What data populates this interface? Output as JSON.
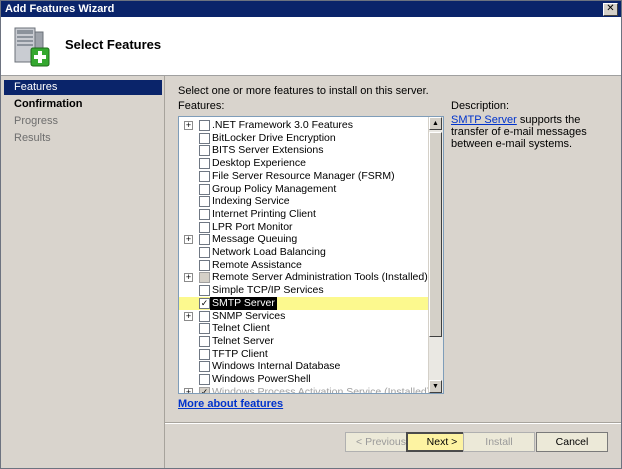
{
  "window": {
    "title": "Add Features Wizard"
  },
  "header": {
    "title": "Select Features"
  },
  "nav": {
    "items": [
      {
        "label": "Features",
        "state": "active"
      },
      {
        "label": "Confirmation",
        "state": "current"
      },
      {
        "label": "Progress",
        "state": "disabled"
      },
      {
        "label": "Results",
        "state": "disabled"
      }
    ]
  },
  "main": {
    "instruction": "Select one or more features to install on this server.",
    "features_label": "Features:",
    "description_label": "Description:",
    "description_link": "SMTP Server",
    "description_text": " supports the transfer of e-mail messages between e-mail systems.",
    "more_link": "More about features",
    "features": [
      {
        "label": ".NET Framework 3.0 Features",
        "expandable": true,
        "checked": false
      },
      {
        "label": "BitLocker Drive Encryption",
        "expandable": false,
        "checked": false
      },
      {
        "label": "BITS Server Extensions",
        "expandable": false,
        "checked": false
      },
      {
        "label": "Desktop Experience",
        "expandable": false,
        "checked": false
      },
      {
        "label": "File Server Resource Manager (FSRM)",
        "expandable": false,
        "checked": false
      },
      {
        "label": "Group Policy Management",
        "expandable": false,
        "checked": false
      },
      {
        "label": "Indexing Service",
        "expandable": false,
        "checked": false
      },
      {
        "label": "Internet Printing Client",
        "expandable": false,
        "checked": false
      },
      {
        "label": "LPR Port Monitor",
        "expandable": false,
        "checked": false
      },
      {
        "label": "Message Queuing",
        "expandable": true,
        "checked": false
      },
      {
        "label": "Network Load Balancing",
        "expandable": false,
        "checked": false
      },
      {
        "label": "Remote Assistance",
        "expandable": false,
        "checked": false
      },
      {
        "label": "Remote Server Administration Tools  (Installed)",
        "expandable": true,
        "checked": false,
        "installed": true
      },
      {
        "label": "Simple TCP/IP Services",
        "expandable": false,
        "checked": false
      },
      {
        "label": "SMTP Server",
        "expandable": false,
        "checked": true,
        "selected": true
      },
      {
        "label": "SNMP Services",
        "expandable": true,
        "checked": false
      },
      {
        "label": "Telnet Client",
        "expandable": false,
        "checked": false
      },
      {
        "label": "Telnet Server",
        "expandable": false,
        "checked": false
      },
      {
        "label": "TFTP Client",
        "expandable": false,
        "checked": false
      },
      {
        "label": "Windows Internal Database",
        "expandable": false,
        "checked": false
      },
      {
        "label": "Windows PowerShell",
        "expandable": false,
        "checked": false
      },
      {
        "label": "Windows Process Activation Service  (Installed)",
        "expandable": true,
        "checked": true,
        "installed": true,
        "faded": true
      }
    ]
  },
  "buttons": {
    "previous": "< Previous",
    "next": "Next >",
    "install": "Install",
    "cancel": "Cancel"
  },
  "icons": {
    "close": "close-icon",
    "server": "server-add-icon",
    "scroll_up": "scroll-up-arrow-icon",
    "scroll_down": "scroll-down-arrow-icon"
  }
}
